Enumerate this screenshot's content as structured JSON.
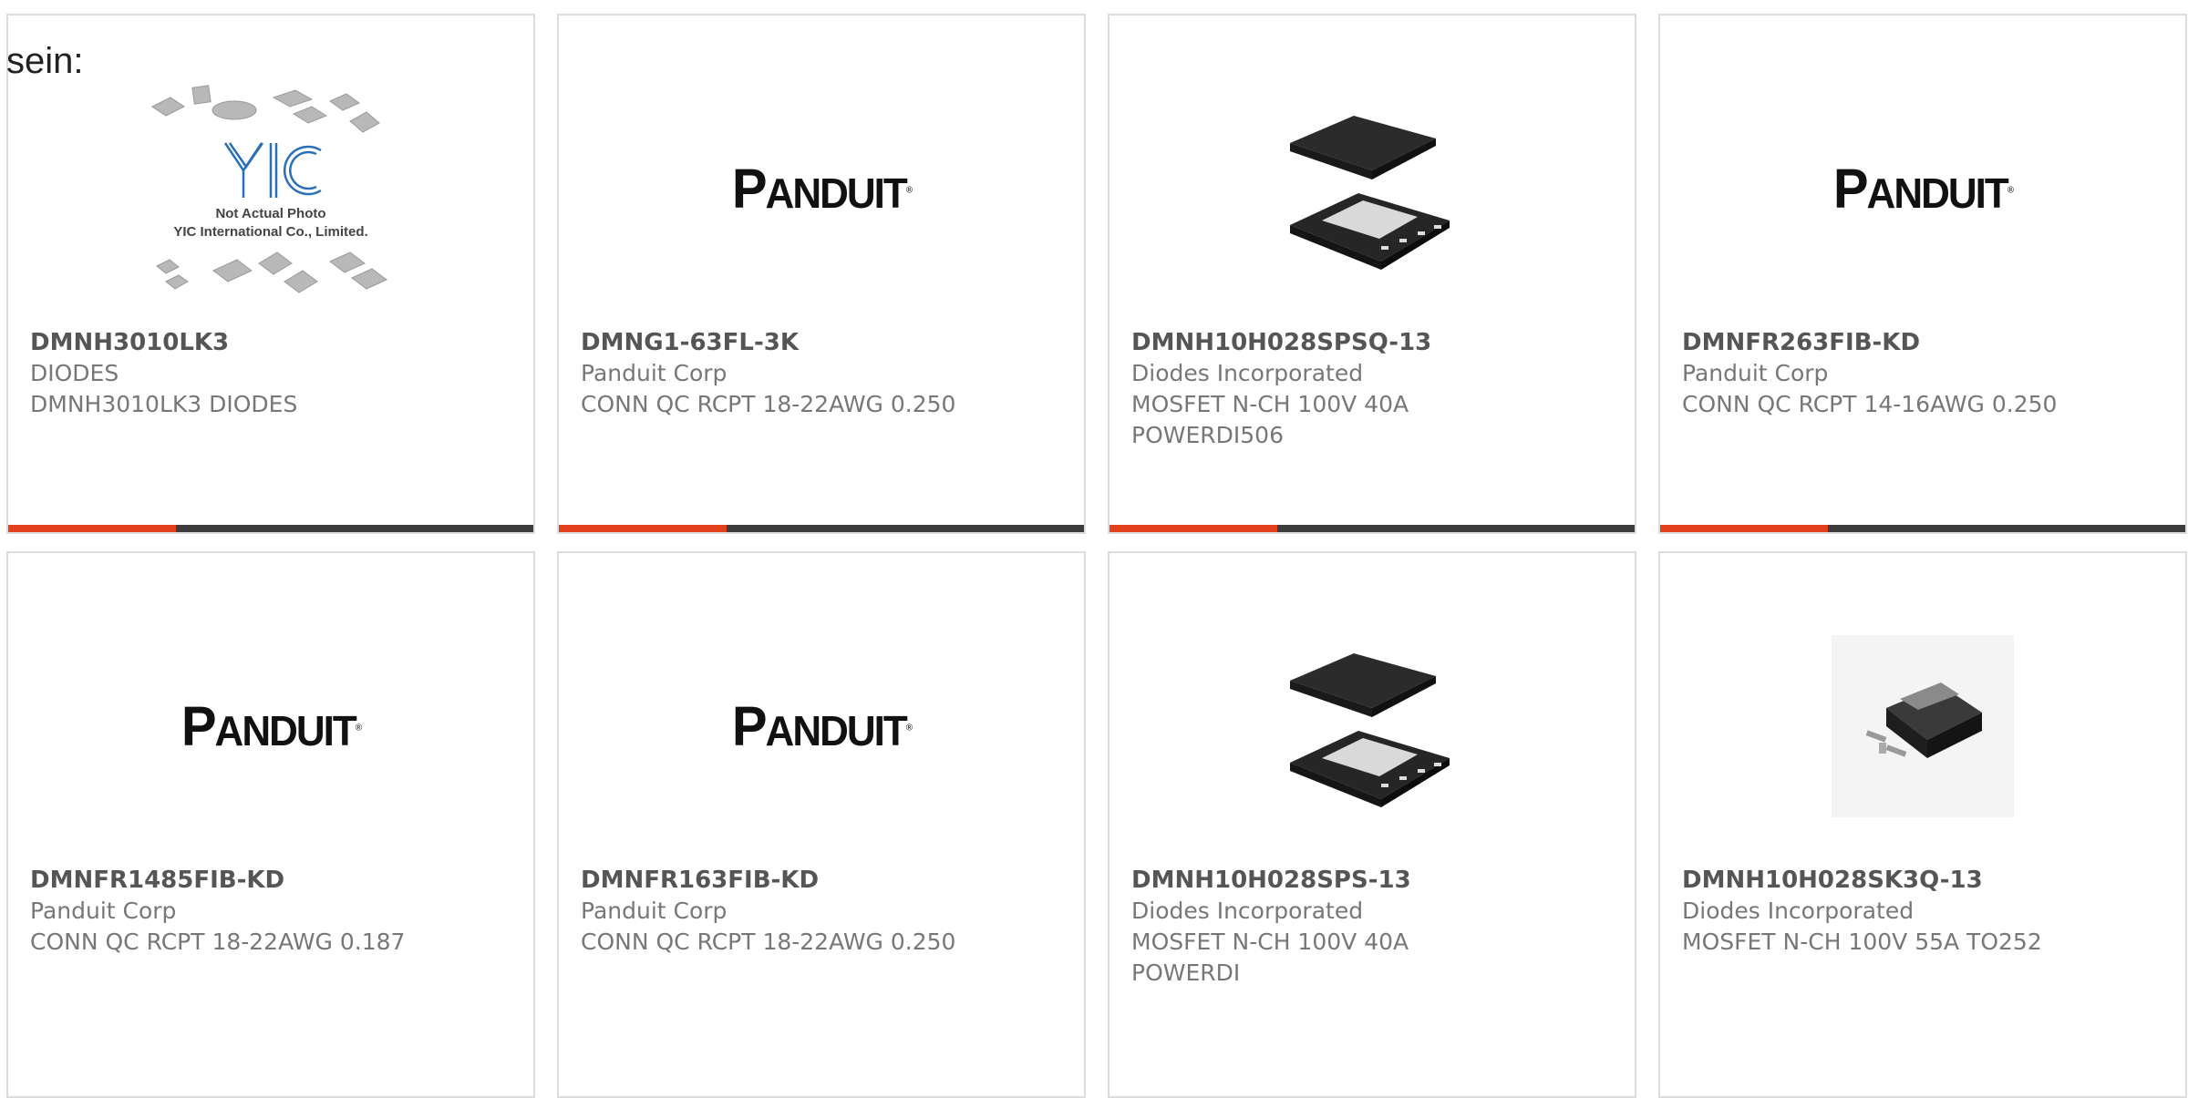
{
  "lead_text": "sein:",
  "accent_color": "#e2401c",
  "track_color": "#3c3c3c",
  "placeholder": {
    "logo_text": "YIC",
    "line1": "Not Actual Photo",
    "line2": "YIC International Co., Limited."
  },
  "panduit_logo": {
    "initial": "P",
    "rest": "ANDUIT",
    "mark": "®"
  },
  "products": [
    {
      "part_number": "DMNH3010LK3",
      "manufacturer": "DIODES",
      "description": "DMNH3010LK3 DIODES",
      "image": "yic-placeholder",
      "progress": 0.32
    },
    {
      "part_number": "DMNG1-63FL-3K",
      "manufacturer": "Panduit Corp",
      "description": "CONN QC RCPT 18-22AWG 0.250",
      "image": "panduit-logo",
      "progress": 0.32
    },
    {
      "part_number": "DMNH10H028SPSQ-13",
      "manufacturer": "Diodes Incorporated",
      "description": "MOSFET N-CH 100V 40A POWERDI506",
      "image": "powerdi-package",
      "progress": 0.32
    },
    {
      "part_number": "DMNFR263FIB-KD",
      "manufacturer": "Panduit Corp",
      "description": "CONN QC RCPT 14-16AWG 0.250",
      "image": "panduit-logo",
      "progress": 0.32
    },
    {
      "part_number": "DMNFR1485FIB-KD",
      "manufacturer": "Panduit Corp",
      "description": "CONN QC RCPT 18-22AWG 0.187",
      "image": "panduit-logo"
    },
    {
      "part_number": "DMNFR163FIB-KD",
      "manufacturer": "Panduit Corp",
      "description": "CONN QC RCPT 18-22AWG 0.250",
      "image": "panduit-logo"
    },
    {
      "part_number": "DMNH10H028SPS-13",
      "manufacturer": "Diodes Incorporated",
      "description": "MOSFET N-CH 100V 40A POWERDI",
      "image": "powerdi-package"
    },
    {
      "part_number": "DMNH10H028SK3Q-13",
      "manufacturer": "Diodes Incorporated",
      "description": "MOSFET N-CH 100V 55A TO252",
      "image": "to252-package"
    }
  ]
}
